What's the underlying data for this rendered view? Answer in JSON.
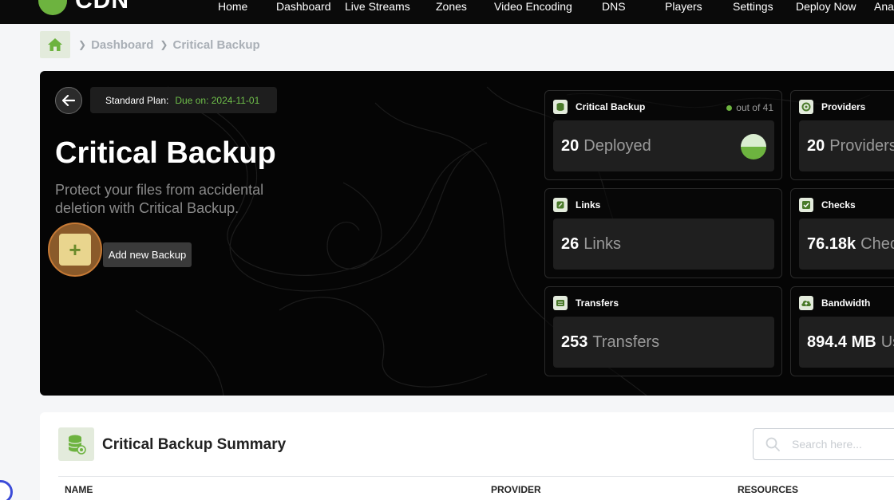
{
  "brand": {
    "name": "CDN"
  },
  "nav": {
    "items": [
      "Home",
      "Dashboard",
      "Live Streams",
      "Zones",
      "Video Encoding",
      "DNS",
      "Players",
      "Settings",
      "Deploy Now",
      "Ana"
    ]
  },
  "breadcrumb": {
    "items": [
      "Dashboard",
      "Critical Backup"
    ]
  },
  "hero": {
    "plan_label": "Standard Plan:",
    "plan_due": "Due on: 2024-11-01",
    "title": "Critical Backup",
    "description": "Protect your files from accidental deletion with Critical Backup.",
    "add_tooltip": "Add new Backup",
    "add_symbol": "+"
  },
  "stats": [
    {
      "label": "Critical Backup",
      "meta": "out of 41",
      "value": "20",
      "unit": "Deployed",
      "icon": "database-icon",
      "deployed_fraction": 0.5
    },
    {
      "label": "Providers",
      "value": "20",
      "unit": "Providers",
      "icon": "gear-icon"
    },
    {
      "label": "Links",
      "value": "26",
      "unit": "Links",
      "icon": "link-icon"
    },
    {
      "label": "Checks",
      "value": "76.18k",
      "unit": "Checks",
      "icon": "check-icon"
    },
    {
      "label": "Transfers",
      "value": "253",
      "unit": "Transfers",
      "icon": "transfer-icon"
    },
    {
      "label": "Bandwidth",
      "value": "894.4 MB",
      "unit": "Used",
      "icon": "cloud-upload-icon"
    }
  ],
  "summary": {
    "title": "Critical Backup Summary",
    "search_placeholder": "Search here...",
    "columns": [
      "NAME",
      "PROVIDER",
      "RESOURCES"
    ]
  },
  "colors": {
    "accent": "#6db33f",
    "dark": "#050505",
    "add_button": "#e9d58e"
  }
}
